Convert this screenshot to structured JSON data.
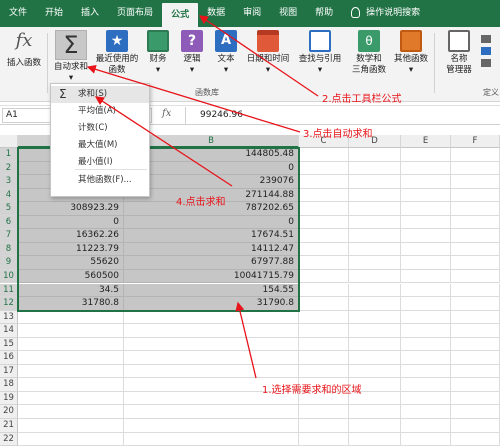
{
  "tabs": [
    "文件",
    "开始",
    "插入",
    "页面布局",
    "公式",
    "数据",
    "审阅",
    "视图",
    "帮助",
    "操作说明搜索"
  ],
  "active_tab": "公式",
  "ribbon": {
    "insert_function": "插入函数",
    "autosum": "自动求和",
    "recent": "最近使用的函数",
    "financial": "财务",
    "logical": "逻辑",
    "text": "文本",
    "datetime": "日期和时间",
    "lookup": "查找与引用",
    "math": "数学和三角函数",
    "more": "其他函数",
    "name_manager": "名称管理器",
    "define": "定义",
    "group_label": "函数库",
    "recent_line1": "最近使用的",
    "recent_line2": "函数",
    "datetime_line": "日期和时间",
    "lookup_line": "查找与引用",
    "math_line1": "数学和",
    "math_line2": "三角函数",
    "name_line1": "名称",
    "name_line2": "管理器",
    "define_trunc": "定义"
  },
  "colors": {
    "excel_green": "#217346",
    "annotation_red": "#e8141a",
    "selection_gray": "#c6c6c6"
  },
  "formula_bar": {
    "name_box": "A1",
    "fx": "fx",
    "value": "99246.96"
  },
  "columns": [
    "A",
    "B",
    "C",
    "D",
    "E",
    "F"
  ],
  "rows": [
    {
      "n": "1",
      "a": "",
      "b": "144805.48"
    },
    {
      "n": "2",
      "a": "",
      "b": "0"
    },
    {
      "n": "3",
      "a": "",
      "b": "239076"
    },
    {
      "n": "4",
      "a": "247385.99",
      "b": "271144.88"
    },
    {
      "n": "5",
      "a": "308923.29",
      "b": "787202.65"
    },
    {
      "n": "6",
      "a": "0",
      "b": "0"
    },
    {
      "n": "7",
      "a": "16362.26",
      "b": "17674.51"
    },
    {
      "n": "8",
      "a": "11223.79",
      "b": "14112.47"
    },
    {
      "n": "9",
      "a": "55620",
      "b": "67977.88"
    },
    {
      "n": "10",
      "a": "560500",
      "b": "10041715.79"
    },
    {
      "n": "11",
      "a": "34.5",
      "b": "154.55"
    },
    {
      "n": "12",
      "a": "31780.8",
      "b": "31790.8"
    },
    {
      "n": "13",
      "a": "",
      "b": ""
    },
    {
      "n": "14",
      "a": "",
      "b": ""
    },
    {
      "n": "15",
      "a": "",
      "b": ""
    },
    {
      "n": "16",
      "a": "",
      "b": ""
    },
    {
      "n": "17",
      "a": "",
      "b": ""
    },
    {
      "n": "18",
      "a": "",
      "b": ""
    },
    {
      "n": "19",
      "a": "",
      "b": ""
    },
    {
      "n": "20",
      "a": "",
      "b": ""
    },
    {
      "n": "21",
      "a": "",
      "b": ""
    },
    {
      "n": "22",
      "a": "",
      "b": ""
    }
  ],
  "autosum_menu": [
    "求和(S)",
    "平均值(A)",
    "计数(C)",
    "最大值(M)",
    "最小值(I)",
    "其他函数(F)..."
  ],
  "annotations": {
    "step1": "1.选择需要求和的区域",
    "step2": "2.点击工具栏公式",
    "step3": "3.点击自动求和",
    "step4": "4.点击求和"
  }
}
